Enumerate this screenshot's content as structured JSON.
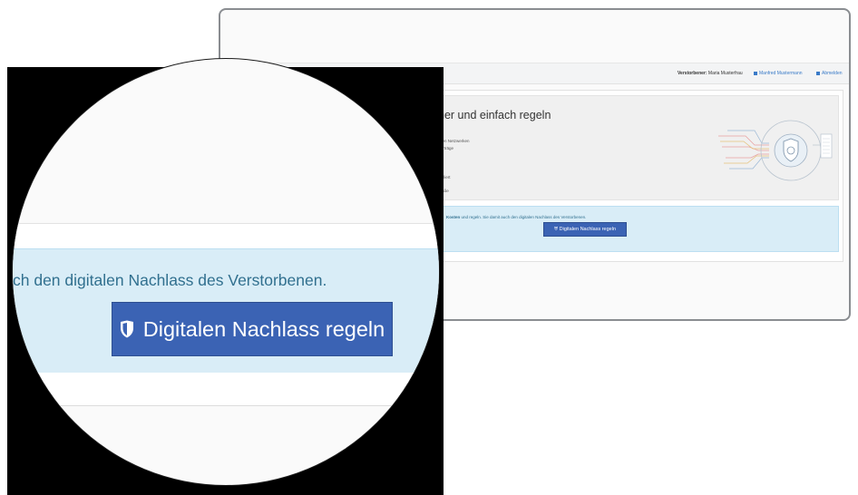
{
  "header": {
    "deceased_label": "Verstorbener:",
    "deceased_name": "Maria Musterfrau",
    "user_name": "Manfred Mustermann",
    "logout_label": "Abmelden"
  },
  "jumbotron": {
    "headline": "her und einfach regeln",
    "bullets": [
      "n",
      "ialen Netzwerken",
      "Verträge",
      "e",
      "trolliert",
      "nraße"
    ]
  },
  "info_band": {
    "bold_text": "Kosten",
    "text": "und regeln. Sie damit auch den digitalen Nachlass des Verstorbenen.",
    "button_label": "Digitalen Nachlass regeln"
  },
  "magnifier": {
    "text": "ch den digitalen Nachlass des Verstorbenen.",
    "button_label": "Digitalen Nachlass regeln"
  },
  "colors": {
    "button_blue": "#3b63b4",
    "info_band": "#d9edf7",
    "info_text": "#31708f",
    "link_blue": "#3a7bc8"
  },
  "icons": {
    "button_icon": "shield-icon",
    "user_icon": "user-icon",
    "logout_icon": "logout-icon"
  }
}
